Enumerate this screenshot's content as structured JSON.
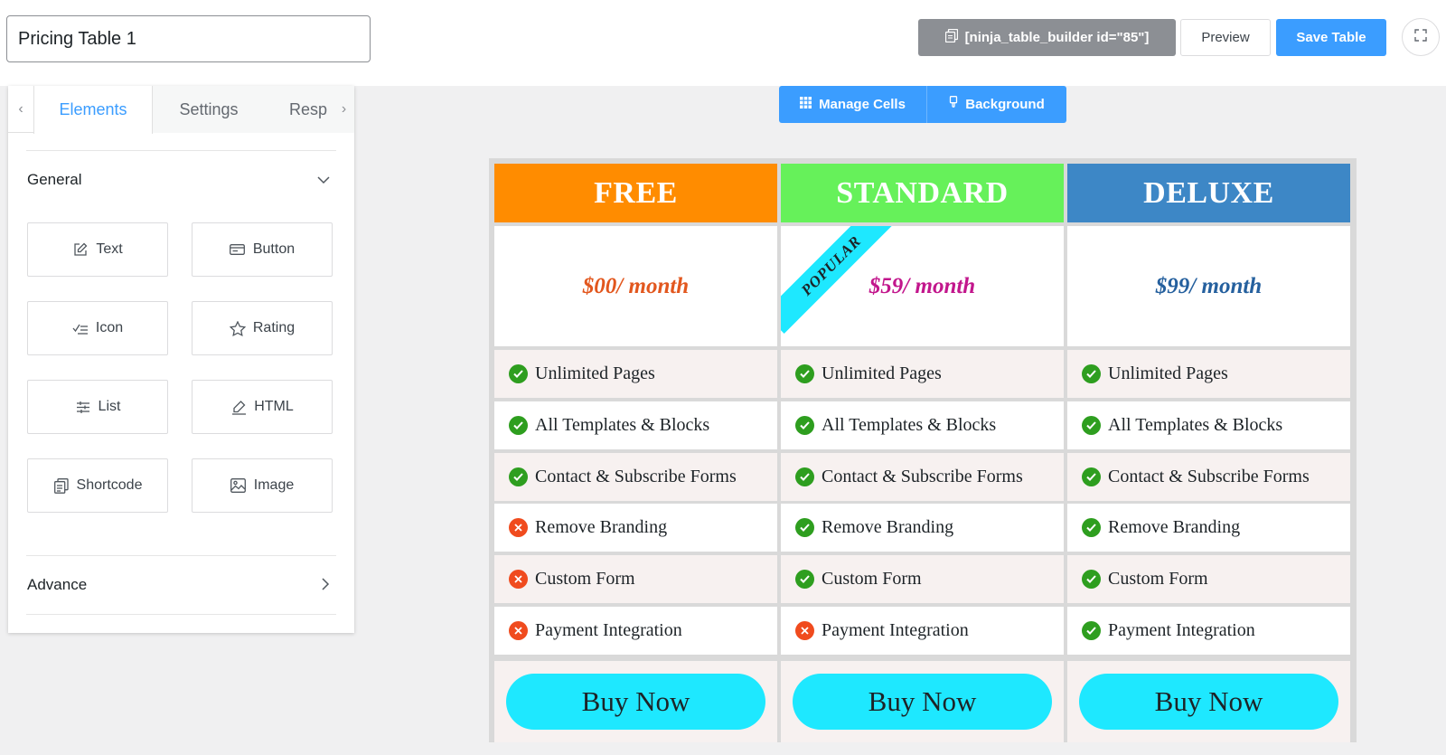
{
  "header": {
    "table_title": "Pricing Table 1",
    "shortcode": "[ninja_table_builder id=\"85\"]",
    "preview_label": "Preview",
    "save_label": "Save Table",
    "icons": {
      "shortcode": "copy-icon",
      "fullscreen": "fullscreen-icon"
    }
  },
  "sidebar": {
    "tabs": [
      {
        "label": "Elements",
        "active": true
      },
      {
        "label": "Settings",
        "active": false
      },
      {
        "label": "Resp",
        "active": false
      }
    ],
    "sections": {
      "general": {
        "label": "General",
        "expanded": true
      },
      "advance": {
        "label": "Advance",
        "expanded": false
      }
    },
    "elements": [
      {
        "label": "Text",
        "icon": "edit-icon"
      },
      {
        "label": "Button",
        "icon": "button-icon"
      },
      {
        "label": "Icon",
        "icon": "checklist-icon"
      },
      {
        "label": "Rating",
        "icon": "star-icon"
      },
      {
        "label": "List",
        "icon": "sliders-icon"
      },
      {
        "label": "HTML",
        "icon": "pen-icon"
      },
      {
        "label": "Shortcode",
        "icon": "shortcode-icon"
      },
      {
        "label": "Image",
        "icon": "image-icon"
      }
    ]
  },
  "canvas_toolbar": {
    "manage_cells_label": "Manage Cells",
    "background_label": "Background"
  },
  "pricing_table": {
    "ribbon_label": "POPULAR",
    "columns": [
      {
        "name": "FREE",
        "header_color": "#ff8c00",
        "price": "$00/ month",
        "price_color": "#e2571e",
        "features": [
          {
            "label": "Unlimited Pages",
            "included": true
          },
          {
            "label": "All Templates & Blocks",
            "included": true
          },
          {
            "label": "Contact & Subscribe Forms",
            "included": true
          },
          {
            "label": "Remove Branding",
            "included": false
          },
          {
            "label": "Custom Form",
            "included": false
          },
          {
            "label": "Payment Integration",
            "included": false
          }
        ],
        "button_label": "Buy Now"
      },
      {
        "name": "STANDARD",
        "header_color": "#66f15a",
        "price": "$59/ month",
        "price_color": "#c2168c",
        "features": [
          {
            "label": "Unlimited Pages",
            "included": true
          },
          {
            "label": "All Templates & Blocks",
            "included": true
          },
          {
            "label": "Contact & Subscribe Forms",
            "included": true
          },
          {
            "label": "Remove Branding",
            "included": true
          },
          {
            "label": "Custom Form",
            "included": true
          },
          {
            "label": "Payment Integration",
            "included": false
          }
        ],
        "button_label": "Buy Now"
      },
      {
        "name": "DELUXE",
        "header_color": "#3d87c6",
        "price": "$99/ month",
        "price_color": "#25609e",
        "features": [
          {
            "label": "Unlimited Pages",
            "included": true
          },
          {
            "label": "All Templates & Blocks",
            "included": true
          },
          {
            "label": "Contact & Subscribe Forms",
            "included": true
          },
          {
            "label": "Remove Branding",
            "included": true
          },
          {
            "label": "Custom Form",
            "included": true
          },
          {
            "label": "Payment Integration",
            "included": true
          }
        ],
        "button_label": "Buy Now"
      }
    ]
  },
  "colors": {
    "accent": "#3b9dff",
    "check_green": "#2e9e1f",
    "cross_red": "#f04b1e",
    "buy_button": "#1ee8ff"
  }
}
